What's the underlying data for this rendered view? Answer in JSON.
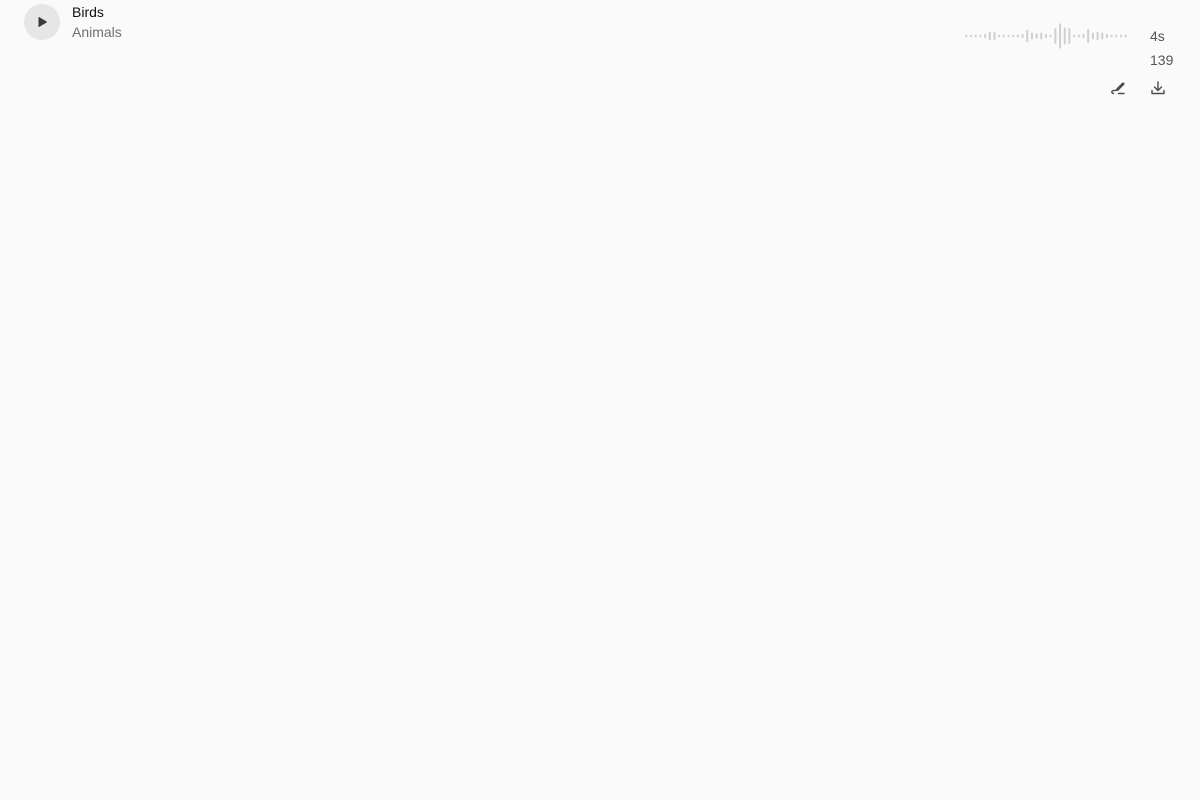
{
  "track": {
    "title": "Birds",
    "category": "Animals",
    "duration": "4s",
    "count": "139"
  },
  "icons": {
    "play": "play-icon",
    "remix": "remix-icon",
    "download": "download-icon"
  },
  "waveform": {
    "color": "#cfcfcf",
    "levels": [
      0.1,
      0.1,
      0.1,
      0.1,
      0.15,
      0.3,
      0.3,
      0.1,
      0.1,
      0.1,
      0.1,
      0.1,
      0.15,
      0.45,
      0.25,
      0.2,
      0.25,
      0.15,
      0.1,
      0.55,
      0.9,
      0.6,
      0.55,
      0.1,
      0.1,
      0.15,
      0.5,
      0.25,
      0.3,
      0.25,
      0.15,
      0.1,
      0.1,
      0.1,
      0.1
    ]
  }
}
